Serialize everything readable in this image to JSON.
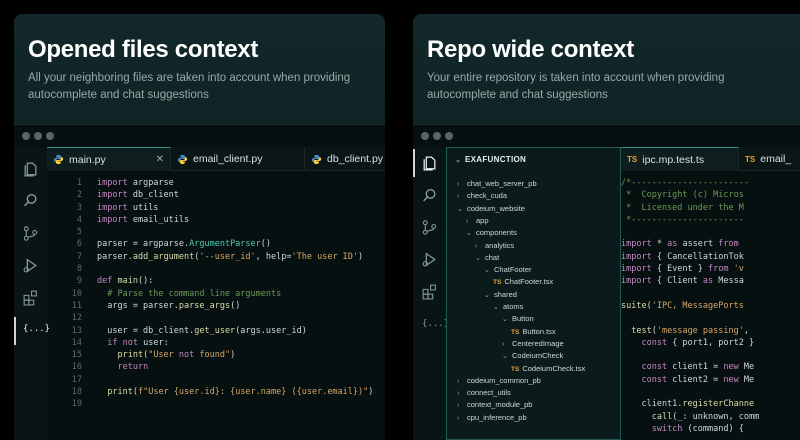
{
  "left": {
    "title": "Opened files context",
    "subtitle": "All your neighboring files are taken into account when providing autocomplete and chat suggestions",
    "tabs": [
      {
        "label": "main.py",
        "icon": "python-icon"
      },
      {
        "label": "email_client.py",
        "icon": "python-icon"
      },
      {
        "label": "db_client.py",
        "icon": "python-icon"
      }
    ],
    "code": [
      {
        "n": "1",
        "t": "import argparse"
      },
      {
        "n": "2",
        "t": "import db_client"
      },
      {
        "n": "3",
        "t": "import utils"
      },
      {
        "n": "4",
        "t": "import email_utils"
      },
      {
        "n": "5",
        "t": ""
      },
      {
        "n": "6",
        "t": "parser = argparse.ArgumentParser()"
      },
      {
        "n": "7",
        "t": "parser.add_argument('--user_id', help='The user ID')"
      },
      {
        "n": "8",
        "t": ""
      },
      {
        "n": "9",
        "t": "def main():"
      },
      {
        "n": "10",
        "t": "  # Parse the command line arguments"
      },
      {
        "n": "11",
        "t": "  args = parser.parse_args()"
      },
      {
        "n": "12",
        "t": ""
      },
      {
        "n": "13",
        "t": "  user = db_client.get_user(args.user_id)"
      },
      {
        "n": "14",
        "t": "  if not user:"
      },
      {
        "n": "15",
        "t": "    print(\"User not found\")"
      },
      {
        "n": "16",
        "t": "    return"
      },
      {
        "n": "17",
        "t": ""
      },
      {
        "n": "18",
        "t": "  print(f\"User {user.id}: {user.name} ({user.email})\")"
      },
      {
        "n": "19",
        "t": ""
      }
    ]
  },
  "right": {
    "title": "Repo wide context",
    "subtitle": "Your entire repository is taken into account when providing autocomplete and chat suggestions",
    "explorer_title": "EXAFUNCTION",
    "tree": [
      {
        "label": "chat_web_server_pb",
        "depth": 0,
        "kind": "closed"
      },
      {
        "label": "check_cuda",
        "depth": 0,
        "kind": "closed"
      },
      {
        "label": "codeium_website",
        "depth": 0,
        "kind": "open"
      },
      {
        "label": "app",
        "depth": 1,
        "kind": "closed"
      },
      {
        "label": "components",
        "depth": 1,
        "kind": "open"
      },
      {
        "label": "analytics",
        "depth": 2,
        "kind": "closed"
      },
      {
        "label": "chat",
        "depth": 2,
        "kind": "open"
      },
      {
        "label": "ChatFooter",
        "depth": 3,
        "kind": "open"
      },
      {
        "label": "ChatFooter.tsx",
        "depth": 4,
        "kind": "ts"
      },
      {
        "label": "shared",
        "depth": 3,
        "kind": "open"
      },
      {
        "label": "atoms",
        "depth": 4,
        "kind": "open"
      },
      {
        "label": "Button",
        "depth": 5,
        "kind": "open"
      },
      {
        "label": "Button.tsx",
        "depth": 6,
        "kind": "ts"
      },
      {
        "label": "CenteredImage",
        "depth": 5,
        "kind": "closed"
      },
      {
        "label": "CodeiumCheck",
        "depth": 5,
        "kind": "open"
      },
      {
        "label": "CodeiumCheck.tsx",
        "depth": 6,
        "kind": "ts"
      },
      {
        "label": "codeium_common_pb",
        "depth": 0,
        "kind": "closed"
      },
      {
        "label": "connect_utils",
        "depth": 0,
        "kind": "closed"
      },
      {
        "label": "context_module_pb",
        "depth": 0,
        "kind": "closed"
      },
      {
        "label": "cpu_inference_pb",
        "depth": 0,
        "kind": "closed"
      }
    ],
    "tabs": [
      {
        "label": "ipc.mp.test.ts",
        "badge": "TS"
      },
      {
        "label": "email_",
        "badge": "TS"
      }
    ],
    "code": [
      "/*-----------------------",
      " *  Copyright (c) Micros",
      " *  Licensed under the M",
      " *----------------------",
      "",
      "import * as assert from",
      "import { CancellationTok",
      "import { Event } from 'v",
      "import { Client as Messa",
      "",
      "suite('IPC, MessagePorts",
      "",
      "  test('message passing',",
      "    const { port1, port2 }",
      "",
      "    const client1 = new Me",
      "    const client2 = new Me",
      "",
      "    client1.registerChanne",
      "      call(_: unknown, comm",
      "      switch (command) {"
    ]
  },
  "colors": {
    "accent": "#2e8d86",
    "keyword": "#c586c0",
    "function": "#dcdcaa",
    "class": "#4ec9b0",
    "string": "#d7a565",
    "comment": "#6a9955",
    "ts_badge": "#e8a23a"
  }
}
